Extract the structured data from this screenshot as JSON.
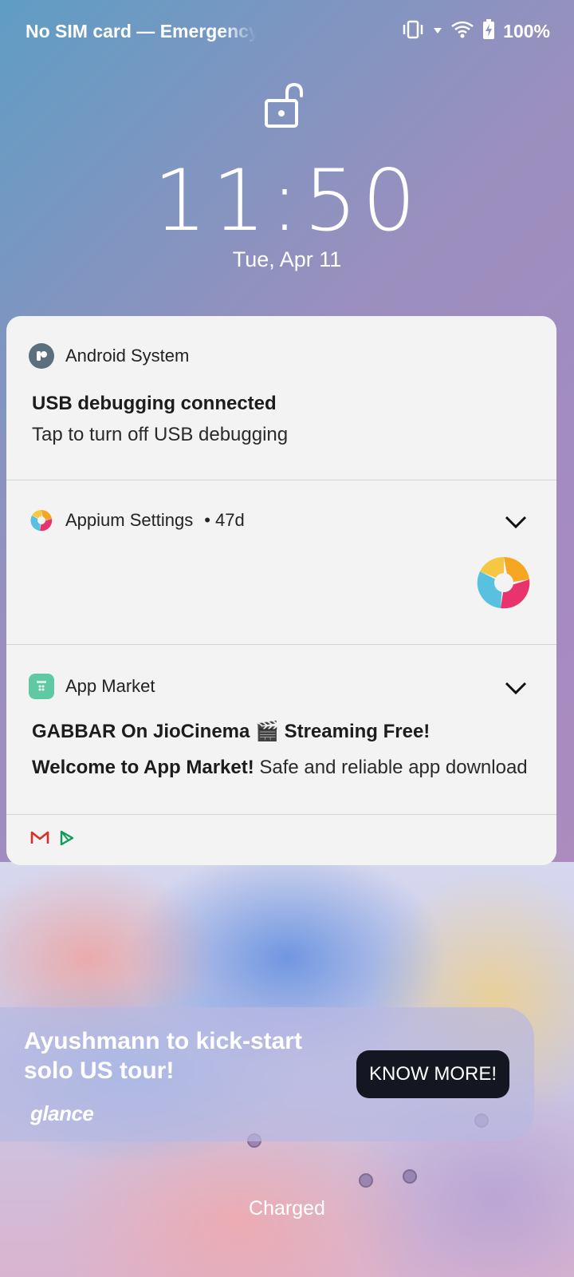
{
  "status_bar": {
    "carrier": "No SIM card — Emergency calls only",
    "battery": "100%"
  },
  "lockscreen": {
    "time": "11:50",
    "date": "Tue, Apr 11"
  },
  "notifications": [
    {
      "app": "Android System",
      "title": "USB debugging connected",
      "text": "Tap to turn off USB debugging"
    },
    {
      "app": "Appium Settings",
      "meta": "• 47d"
    },
    {
      "app": "App Market",
      "line1": "GABBAR On JioCinema 🎬 Streaming Free!",
      "line2_title": "Welcome to App Market!",
      "line2_text": "Safe and reliable app download"
    }
  ],
  "overflow_icons": [
    "gmail-icon",
    "play-store-icon"
  ],
  "glance": {
    "headline": "Ayushmann to kick-start solo US tour!",
    "cta": "KNOW MORE!",
    "brand": "glance"
  },
  "footer": {
    "charging_status": "Charged"
  },
  "colors": {
    "panel_bg": "#f3f3f4",
    "cta_bg": "#141722",
    "app_market_green": "#5fc9a4"
  }
}
